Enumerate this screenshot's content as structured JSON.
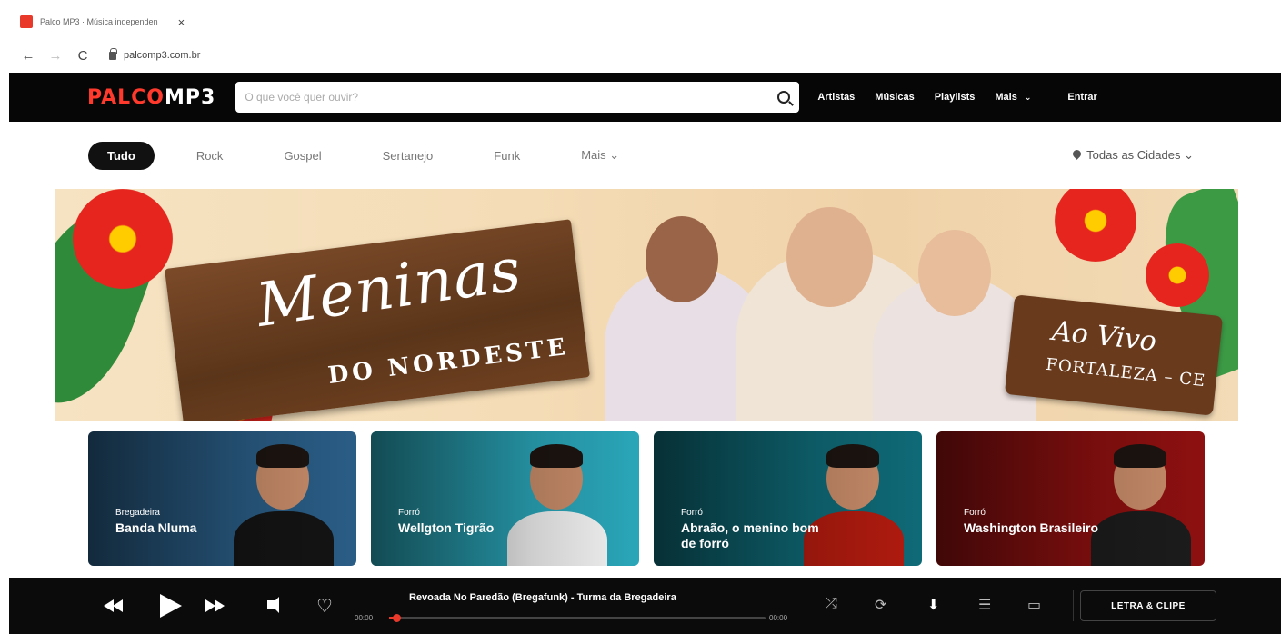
{
  "browser": {
    "tab_title": "Palco MP3 · Música independen",
    "tab_close": "×",
    "back": "←",
    "forward": "→",
    "reload": "C",
    "url": "palcomp3.com.br"
  },
  "header": {
    "logo_palco": "PALCO",
    "logo_mp3": "MP3",
    "search_placeholder": "O que você quer ouvir?",
    "nav": [
      "Artistas",
      "Músicas",
      "Playlists",
      "Mais"
    ],
    "more_caret": "⌄",
    "login": "Entrar"
  },
  "genres": {
    "items": [
      "Tudo",
      "Rock",
      "Gospel",
      "Sertanejo",
      "Funk",
      "Mais ⌄"
    ],
    "active_index": 0,
    "city": "Todas as Cidades ⌄"
  },
  "banner": {
    "title": "Meninas",
    "subtitle": "DO NORDESTE",
    "tag_line1": "Ao Vivo",
    "tag_line2": "FORTALEZA – CE"
  },
  "cards": [
    {
      "genre": "Bregadeira",
      "title": "Banda Nluma",
      "bg": "#2a5d86",
      "body": "#141414"
    },
    {
      "genre": "Forró",
      "title": "Wellgton Tigrão",
      "bg": "#2aa6b9",
      "body": "#f2f2f2"
    },
    {
      "genre": "Forró",
      "title": "Abraão, o menino bom de forró",
      "bg": "#0f6a77",
      "body": "#b21b0f"
    },
    {
      "genre": "Forró",
      "title": "Washington Brasileiro",
      "bg": "#8e1010",
      "body": "#1c1c1c"
    }
  ],
  "player": {
    "track": "Revoada No Paredão (Bregafunk) - Turma da Bregadeira",
    "time_current": "00:00",
    "time_total": "00:00",
    "progress": 0.02,
    "lyrics_button": "LETRA & CLIPE",
    "icons": {
      "shuffle": "⤮",
      "repeat": "⟳",
      "download": "⬇",
      "queue": "☰",
      "cast": "▭"
    },
    "heart": "♡"
  },
  "colors": {
    "accent": "#e8392b",
    "header_bg": "#060606",
    "player_bg": "#0b0b0b"
  }
}
